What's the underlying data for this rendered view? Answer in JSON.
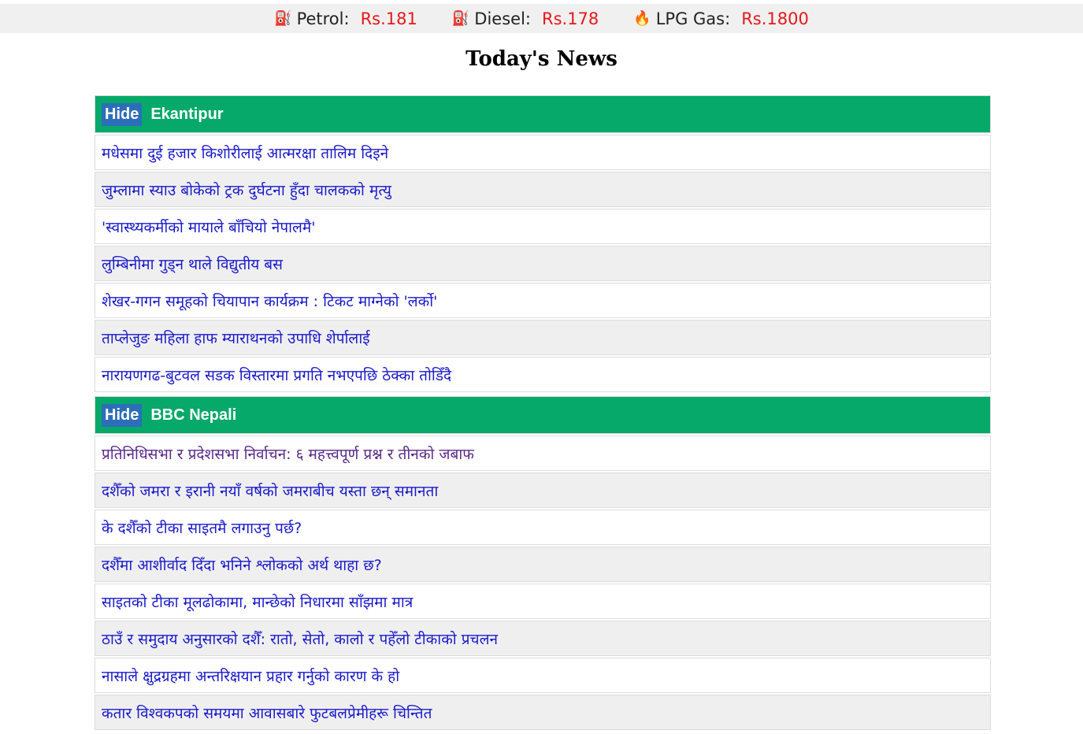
{
  "fuel_prices": [
    {
      "icon": "fuel-pump-icon",
      "glyph": "⛽",
      "label": "Petrol:",
      "price": "Rs.181"
    },
    {
      "icon": "fuel-pump-icon",
      "glyph": "⛽",
      "label": "Diesel:",
      "price": "Rs.178"
    },
    {
      "icon": "flame-icon",
      "glyph": "🔥",
      "label": "LPG Gas:",
      "price": "Rs.1800"
    }
  ],
  "page_title": "Today's News",
  "colors": {
    "header_green": "#06a96a",
    "hide_blue": "#2d6eb8",
    "price_red": "#e8171b",
    "link_blue": "#1a1acc",
    "visited_purple": "#5a2a8a"
  },
  "sources": [
    {
      "hide_label": "Hide",
      "name": "Ekantipur",
      "items": [
        "मधेसमा दुई हजार किशोरीलाई आत्मरक्षा तालिम दिइने",
        "जुम्लामा स्याउ बोकेको ट्रक दुर्घटना हुँदा चालकको मृत्यु",
        "'स्वास्थ्यकर्मीको मायाले बाँचियो नेपालमै'",
        "लुम्बिनीमा गुड्न थाले विद्युतीय बस",
        "शेखर-गगन समूहको चियापान कार्यक्रम : टिकट माग्नेको 'लर्को'",
        "ताप्लेजुङ महिला हाफ म्याराथनको उपाधि शेर्पालाई",
        "नारायणगढ-बुटवल सडक विस्तारमा प्रगति नभएपछि ठेक्का तोडिँदै"
      ]
    },
    {
      "hide_label": "Hide",
      "name": "BBC Nepali",
      "items": [
        "प्रतिनिधिसभा र प्रदेशसभा निर्वाचन: ६ महत्त्वपूर्ण प्रश्न र तीनको जबाफ",
        "दशैँको जमरा र इरानी नयाँ वर्षको जमराबीच यस्ता छन् समानता",
        "के दशैँको टीका साइतमै लगाउनु पर्छ?",
        "दशैँमा आशीर्वाद दिँदा भनिने श्लोकको अर्थ थाहा छ?",
        "साइतको टीका मूलढोकामा, मान्छेको निधारमा साँझमा मात्र",
        "ठाउँ र समुदाय अनुसारको दशैँ: रातो, सेतो, कालो र पहेँलो टीकाको प्रचलन",
        "नासाले क्षुद्रग्रहमा अन्तरिक्षयान प्रहार गर्नुको कारण के हो",
        "कतार विश्वकपको समयमा आवासबारे फुटबलप्रेमीहरू चिन्तित"
      ]
    }
  ]
}
